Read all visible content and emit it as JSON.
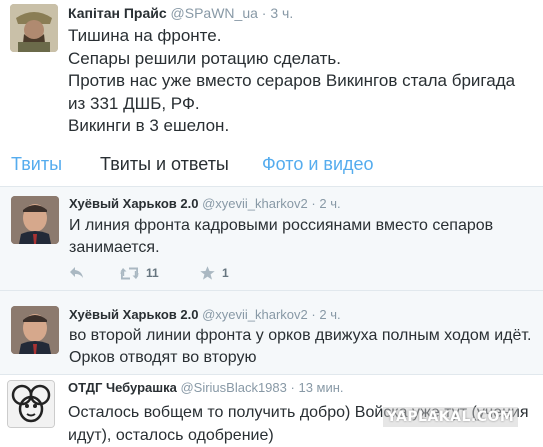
{
  "tweets": [
    {
      "name": "Капітан Прайс",
      "handle": "@SPaWN_ua",
      "time": "3 ч.",
      "lines": [
        "Тишина на фронте.",
        "Сепары решили ротацию сделать.",
        "Против нас уже вместо сераров Викингов стала бригада из 331 ДШБ, РФ.",
        "Викинги в 3 ешелон."
      ]
    },
    {
      "name": "Хуёвый Харьков 2.0",
      "handle": "@xyevii_kharkov2",
      "time": "2 ч.",
      "text": "И  линия фронта кадровыми россиянами вместо сепаров занимается.",
      "actions": {
        "retweets": "11",
        "favorites": "1"
      }
    },
    {
      "name": "Хуёвый Харьков 2.0",
      "handle": "@xyevii_kharkov2",
      "time": "2 ч.",
      "text": "во второй линии фронта у орков движуха полным ходом идёт. Орков отводят во вторую"
    },
    {
      "name": "ОТДГ Чебурашка",
      "handle": "@SiriusBlack1983",
      "time": "13 мин.",
      "text": "Осталось вобщем то получить добро) Войска уже тут (учения идут), осталось одобрение)"
    }
  ],
  "tabs": {
    "tweets": "Твиты",
    "replies": "Твиты и ответы",
    "media": "Фото и видео"
  },
  "separator": "·",
  "watermark": "YAPLAKAL.COM",
  "icons": {
    "reply": "reply-icon",
    "retweet": "retweet-icon",
    "favorite": "star-icon"
  },
  "colors": {
    "accent": "#55acee",
    "muted": "#8899a6",
    "text": "#292f33",
    "stream_bg": "#f5f8fa"
  }
}
